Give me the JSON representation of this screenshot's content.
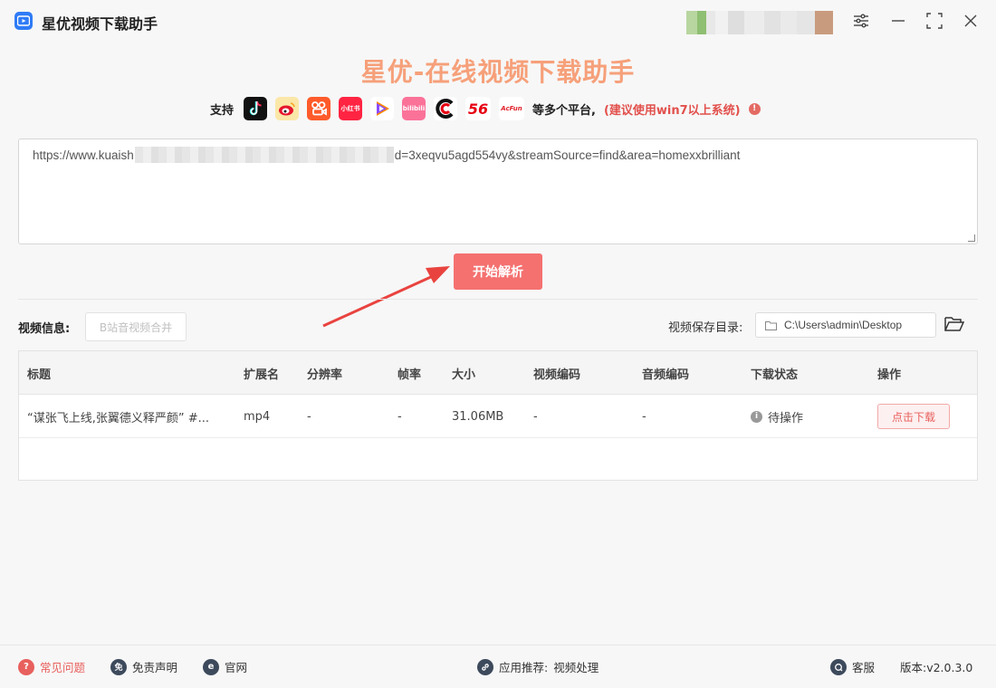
{
  "app": {
    "title": "星优视频下载助手",
    "hero_title": "星优-在线视频下载助手"
  },
  "platforms": {
    "support_label": "支持",
    "icons": [
      "tiktok-icon",
      "weibo-icon",
      "kuaishou-icon",
      "xiaohongshu-icon",
      "tencent-video-icon",
      "bilibili-icon",
      "cctv-icon",
      "56-icon",
      "acfun-icon"
    ],
    "badge_56": "56",
    "badge_xhs": "小红书",
    "badge_bili": "bilibili",
    "badge_acfun": "AcFun",
    "more_label": "等多个平台,",
    "warning": "(建议使用win7以上系统)"
  },
  "url_input": {
    "prefix": "https://www.kuaish",
    "suffix": "d=3xeqvu5agd554vy&streamSource=find&area=homexxbrilliant"
  },
  "parse_button": "开始解析",
  "video_info": {
    "label": "视频信息:",
    "merge_button": "B站音视频合并",
    "save_dir_label": "视频保存目录:",
    "save_dir_value": "C:\\Users\\admin\\Desktop"
  },
  "table": {
    "headers": [
      "标题",
      "扩展名",
      "分辨率",
      "帧率",
      "大小",
      "视频编码",
      "音频编码",
      "下载状态",
      "操作"
    ],
    "rows": [
      {
        "title": "“谋张飞上线,张翼德义释严颜” #...",
        "ext": "mp4",
        "resolution": "-",
        "fps": "-",
        "size": "31.06MB",
        "vcodec": "-",
        "acodec": "-",
        "status": "待操作",
        "action": "点击下载"
      }
    ]
  },
  "footer": {
    "faq": "常见问题",
    "disclaimer": "免责声明",
    "website": "官网",
    "recommend_label": "应用推荐:",
    "recommend_value": "视频处理",
    "support": "客服",
    "version": "版本:v2.0.3.0"
  },
  "colors": {
    "accent": "#f47170",
    "hero": "#f6a07a",
    "warning": "#e2504c"
  }
}
